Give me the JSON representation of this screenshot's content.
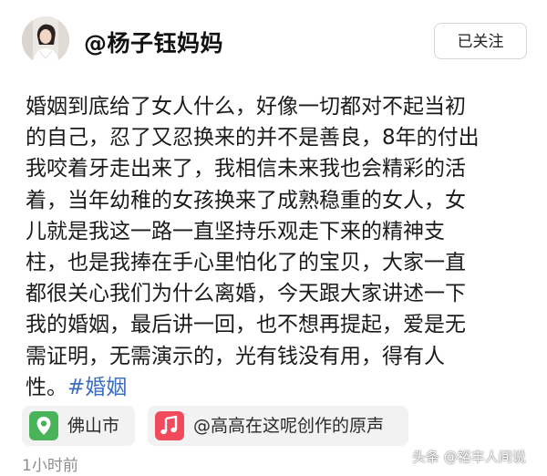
{
  "header": {
    "username": "@杨子钰妈妈",
    "follow_label": "已关注"
  },
  "post": {
    "lines": [
      "婚姻到底给了女人什么，好像一切都对不起当初",
      "的自己，忍了又忍换来的并不是善良，8年的付出",
      "我咬着牙走出来了，我相信未来我也会精彩的活",
      "着，当年幼稚的女孩换来了成熟稳重的女人，女",
      "儿就是我这一路一直坚持乐观走下来的精神支",
      "柱，也是我捧在手心里怕化了的宝贝，大家一直",
      "都很关心我们为什么离婚，今天跟大家讲述一下",
      "我的婚姻，最后讲一回，也不想再提起，爱是无",
      "需证明，无需演示的，光有钱没有用，得有人"
    ],
    "last_line_text": "性。",
    "hashtag": "#婚姻"
  },
  "chips": {
    "location": {
      "label": "佛山市",
      "icon": "location-pin-icon",
      "color": "#49b35a"
    },
    "music": {
      "label": "@高高在这呢创作的原声",
      "icon": "music-note-icon",
      "color": "#f04a5c"
    }
  },
  "timestamp": "1小时前",
  "watermark": "头条 @裕丰人间说",
  "colors": {
    "hashtag": "#3c6ebf",
    "chip_background": "#f2f2f2",
    "timestamp": "#8d8d8d"
  }
}
